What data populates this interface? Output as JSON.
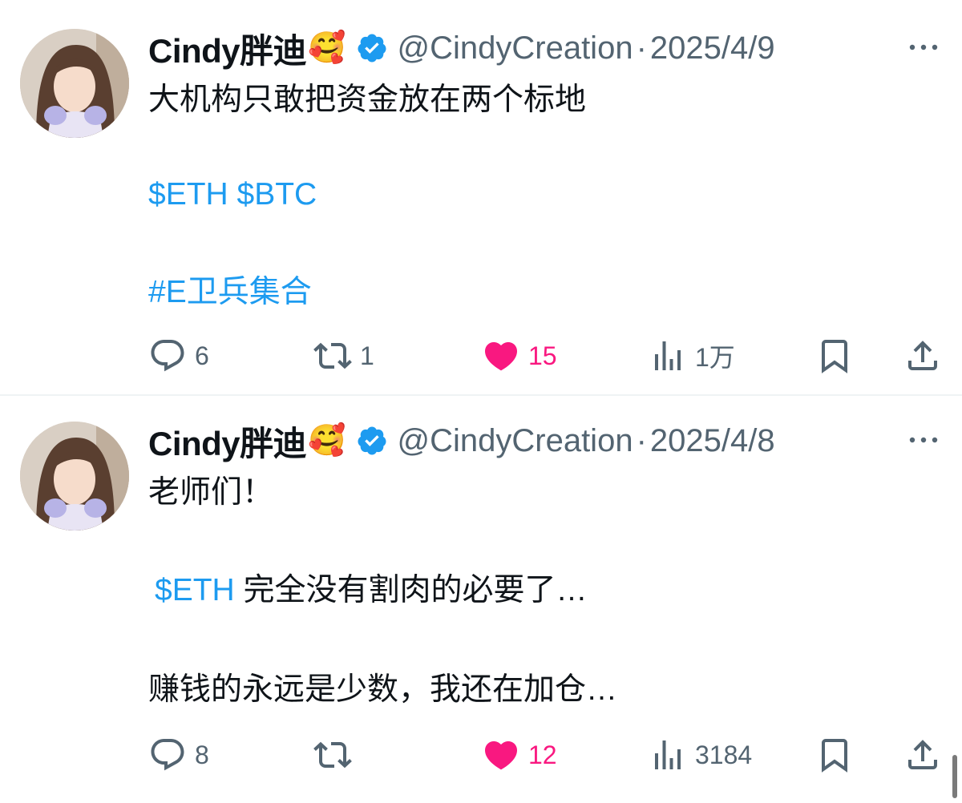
{
  "tweets": [
    {
      "author": {
        "name": "Cindy胖迪",
        "emoji": "🥰",
        "handle": "@CindyCreation",
        "verified": true
      },
      "separator": "·",
      "date": "2025/4/9",
      "lines": [
        {
          "text": "大机构只敢把资金放在两个标地",
          "type": "text"
        },
        {
          "text": "$ETH $BTC",
          "type": "link"
        },
        {
          "text": "#E卫兵集合",
          "type": "link"
        }
      ],
      "stats": {
        "replies": "6",
        "reposts": "1",
        "likes": "15",
        "views": "1万"
      }
    },
    {
      "author": {
        "name": "Cindy胖迪",
        "emoji": "🥰",
        "handle": "@CindyCreation",
        "verified": true
      },
      "separator": "·",
      "date": "2025/4/8",
      "lines": [
        {
          "text": "老师们！",
          "type": "text"
        },
        {
          "cashtag": "$ETH",
          "text": "完全没有割肉的必要了…",
          "type": "mixed"
        },
        {
          "text": "赚钱的永远是少数，我还在加仓…",
          "type": "text"
        }
      ],
      "stats": {
        "replies": "8",
        "reposts": "",
        "likes": "12",
        "views": "3184"
      }
    }
  ],
  "colors": {
    "link": "#1d9bf0",
    "muted": "#536471",
    "like": "#f91880",
    "verified": "#1d9bf0"
  },
  "icons": [
    "more-icon",
    "verified-badge-icon",
    "reply-icon",
    "repost-icon",
    "like-heart-icon",
    "views-icon",
    "bookmark-icon",
    "share-icon"
  ]
}
